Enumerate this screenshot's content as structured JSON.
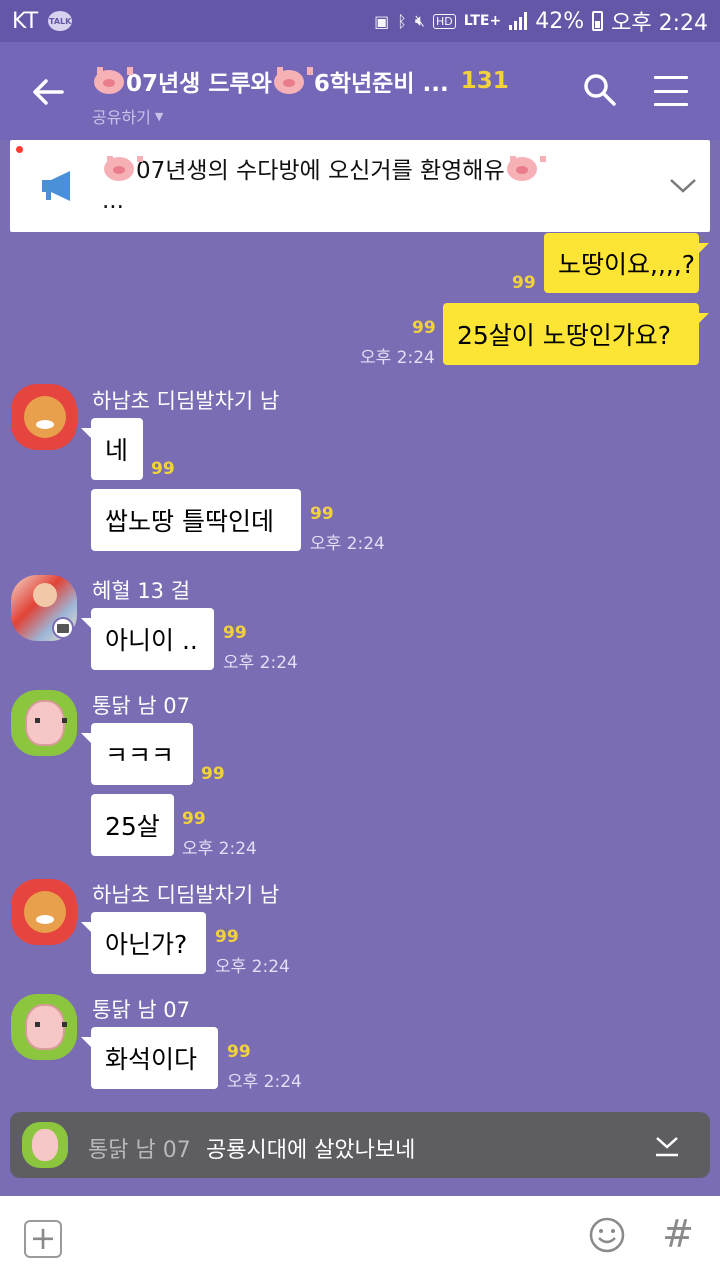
{
  "status_bar": {
    "carrier": "KT",
    "talk_badge": "TALK",
    "network": "LTE+",
    "battery": "42%",
    "time": "오후 2:24",
    "icons": [
      "talk-notification-icon",
      "data-saver-icon",
      "bluetooth-icon",
      "mute-icon",
      "hd-voice-icon",
      "lte-icon",
      "signal-icon",
      "battery-icon"
    ]
  },
  "header": {
    "title_prefix": "07년생 드루와",
    "title_suffix": "6학년준비 ...",
    "member_count": "131",
    "share_label": "공유하기",
    "icons": [
      "back-arrow-icon",
      "search-icon",
      "menu-icon"
    ]
  },
  "notice": {
    "line1": "07년생의 수다방에 오신거를 환영해유",
    "line2": "...",
    "accent_color": "#4a90d9"
  },
  "messages": {
    "m1": {
      "text": "노땅이요,,,,?",
      "unread": "99"
    },
    "m2": {
      "text": "25살이 노땅인가요?",
      "unread": "99",
      "time": "오후 2:24"
    },
    "g1": {
      "sender": "하남초 디딤발차기 남",
      "b1": {
        "text": "네",
        "unread": "99"
      },
      "b2": {
        "text": "쌉노땅 틀딱인데",
        "unread": "99",
        "time": "오후 2:24"
      }
    },
    "g2": {
      "sender": "혜혈 13 걸",
      "b1": {
        "text": "아니이 ..",
        "unread": "99",
        "time": "오후 2:24"
      }
    },
    "g3": {
      "sender": "통닭 남 07",
      "b1": {
        "text": "ㅋㅋㅋ",
        "unread": "99"
      },
      "b2": {
        "text": "25살",
        "unread": "99",
        "time": "오후 2:24"
      }
    },
    "g4": {
      "sender": "하남초 디딤발차기 남",
      "b1": {
        "text": "아닌가?",
        "unread": "99",
        "time": "오후 2:24"
      }
    },
    "g5": {
      "sender": "통닭 남 07",
      "b1": {
        "text": "화석이다",
        "unread": "99",
        "time": "오후 2:24"
      }
    }
  },
  "preview": {
    "sender": "통닭 남 07",
    "text": "공룡시대에 살았나보네"
  },
  "input_bar": {
    "placeholder": "",
    "hash_label": "#",
    "plus_label": "+"
  },
  "colors": {
    "background": "#7a6db3",
    "my_bubble": "#fde536",
    "unread": "#f2d23b"
  }
}
